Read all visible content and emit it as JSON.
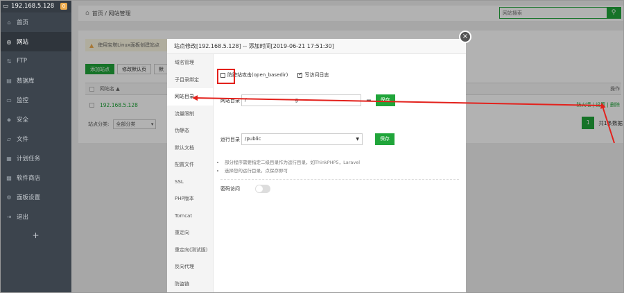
{
  "sidebar": {
    "ip": "192.168.5.128",
    "badge": "0",
    "items": [
      {
        "label": "首页",
        "icon": "home-icon",
        "glyph": "⌂"
      },
      {
        "label": "网站",
        "icon": "globe-icon",
        "glyph": "◎"
      },
      {
        "label": "FTP",
        "icon": "ftp-icon",
        "glyph": "⇅"
      },
      {
        "label": "数据库",
        "icon": "database-icon",
        "glyph": "▤"
      },
      {
        "label": "监控",
        "icon": "monitor-icon",
        "glyph": "▭"
      },
      {
        "label": "安全",
        "icon": "shield-icon",
        "glyph": "◈"
      },
      {
        "label": "文件",
        "icon": "folder-icon",
        "glyph": "▱"
      },
      {
        "label": "计划任务",
        "icon": "calendar-icon",
        "glyph": "▦"
      },
      {
        "label": "软件商店",
        "icon": "grid-icon",
        "glyph": "▩"
      },
      {
        "label": "面板设置",
        "icon": "gear-icon",
        "glyph": "⚙"
      },
      {
        "label": "退出",
        "icon": "logout-icon",
        "glyph": "⇥"
      }
    ],
    "active_index": 1,
    "plus": "+"
  },
  "topbar": {
    "home_icon": "⌂",
    "breadcrumb": "首页 / 网站管理",
    "search_placeholder": "网站搜索",
    "search_icon": "⚲"
  },
  "main": {
    "notice": "使用宝塔Linux面板创建站点",
    "buttons": [
      "添加站点",
      "修改默认页",
      "默"
    ],
    "table": {
      "col_name": "网站名 ▲",
      "col_ops": "操作",
      "row_site": "192.168.5.128",
      "row_actions": "防火墙 | 设置 | 删除"
    },
    "filter_label": "站点分类:",
    "filter_value": "全部分类",
    "page": "1",
    "total": "共1条数据"
  },
  "dialog": {
    "title": "站点修改[192.168.5.128] -- 添加时间[2019-06-21 17:51:30]",
    "close": "×",
    "menu": [
      "域名管理",
      "子目录绑定",
      "网站目录",
      "流量限制",
      "伪静态",
      "默认文档",
      "配置文件",
      "SSL",
      "PHP版本",
      "Tomcat",
      "重定向",
      "重定向(测试版)",
      "反向代理",
      "防盗链"
    ],
    "active_menu": 2,
    "anti_xss": "防跨站攻击(open_basedir)",
    "access_log": "写访问日志",
    "site_dir_label": "网站目录",
    "site_dir_value": "/",
    "site_dir_tail": "g",
    "run_dir_label": "运行目录",
    "run_dir_value": "/public",
    "save": "保存",
    "tips": [
      "部分程序需要指定二级目录作为运行目录，如ThinkPHP5，Laravel",
      "选择您的运行目录，点保存即可"
    ],
    "pwd_label": "密码访问"
  },
  "colors": {
    "accent": "#20a53a",
    "annotation": "#e3211c"
  }
}
